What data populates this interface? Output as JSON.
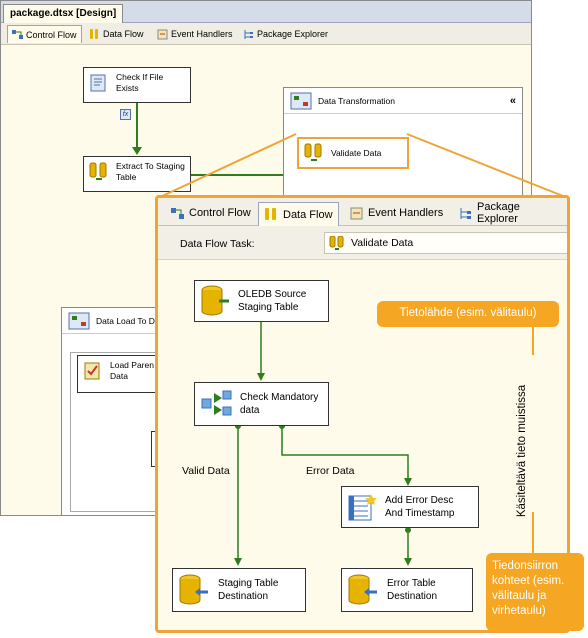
{
  "background_window": {
    "doc_tab": "package.dtsx [Design]",
    "designer_tabs": [
      "Control Flow",
      "Data Flow",
      "Event Handlers",
      "Package Explorer"
    ],
    "tasks": {
      "check_file": "Check If File Exists",
      "extract": "Extract To Staging Table",
      "data_transformation": "Data Transformation",
      "validate": "Validate Data",
      "data_load": "Data Load To D",
      "load_parent": "Load Paren Data",
      "fx_badge": "fx"
    }
  },
  "popup": {
    "tabs": [
      "Control Flow",
      "Data Flow",
      "Event Handlers",
      "Package Explorer"
    ],
    "active_tab": "Data Flow",
    "task_label": "Data Flow Task:",
    "task_value": "Validate Data",
    "components": {
      "source": "OLEDB Source Staging Table",
      "check": "Check Mandatory data",
      "add_error": "Add Error Desc And Timestamp",
      "staging_dest": "Staging Table Destination",
      "error_dest": "Error Table Destination"
    },
    "edge_labels": {
      "valid": "Valid Data",
      "error": "Error Data"
    }
  },
  "annotations": {
    "source_note": "Tietolähde (esim. välitaulu)",
    "memory_note": "Käsiteltävä tieto muistissa",
    "destination_note": "Tiedonsiirron kohteet (esim. välitaulu ja virhetaulu)"
  },
  "colors": {
    "highlight": "#f0a336",
    "note_bg": "#f5a623",
    "arrow": "#2e7d1e",
    "canvas": "#fffbea"
  }
}
